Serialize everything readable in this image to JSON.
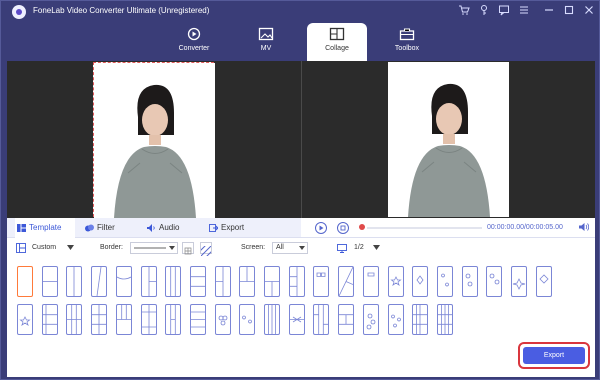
{
  "app": {
    "title": "FoneLab Video Converter Ultimate (Unregistered)",
    "accent_color": "#3a3d78",
    "window_icons": [
      "cart-icon",
      "key-icon",
      "feedback-icon",
      "menu-icon",
      "minimize-icon",
      "maximize-icon",
      "close-icon"
    ]
  },
  "tabs": [
    {
      "label": "Converter",
      "icon": "converter-icon"
    },
    {
      "label": "MV",
      "icon": "mv-icon"
    },
    {
      "label": "Collage",
      "icon": "collage-icon",
      "active": true
    },
    {
      "label": "Toolbox",
      "icon": "toolbox-icon"
    }
  ],
  "subtabs": [
    {
      "label": "Template",
      "icon": "template-icon",
      "active": true
    },
    {
      "label": "Filter",
      "icon": "filter-icon"
    },
    {
      "label": "Audio",
      "icon": "audio-icon"
    },
    {
      "label": "Export",
      "icon": "export-icon"
    }
  ],
  "player": {
    "time": "00:00:00.00/00:00:05.00",
    "progress_fraction": 0.0
  },
  "options": {
    "custom_label": "Custom",
    "border_label": "Border:",
    "screen_label": "Screen:",
    "screen_value": "All",
    "page_value": "1/2"
  },
  "export_button": "Export"
}
